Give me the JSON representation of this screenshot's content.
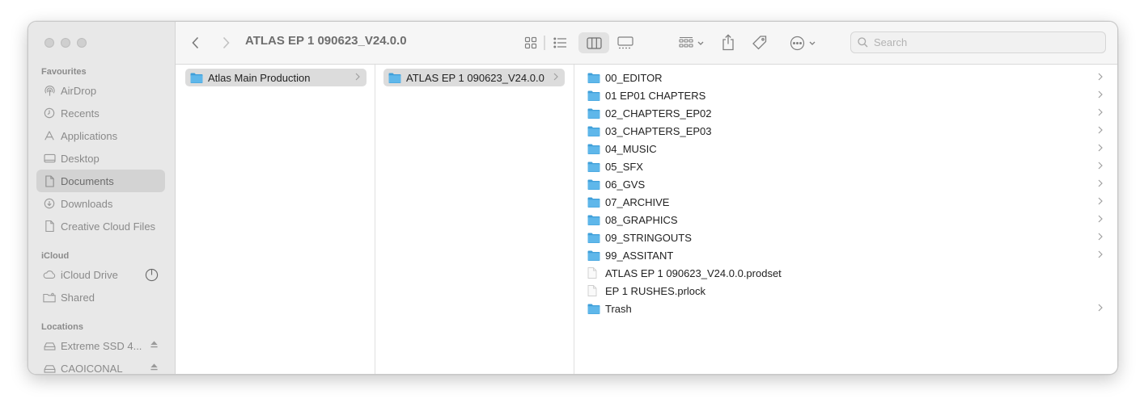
{
  "window": {
    "path_title": "ATLAS EP 1 090623_V24.0.0"
  },
  "search": {
    "placeholder": "Search"
  },
  "sidebar": {
    "sections": [
      {
        "label": "Favourites",
        "items": [
          {
            "label": "AirDrop",
            "icon": "airdrop-icon"
          },
          {
            "label": "Recents",
            "icon": "clock-icon"
          },
          {
            "label": "Applications",
            "icon": "applications-icon"
          },
          {
            "label": "Desktop",
            "icon": "desktop-icon"
          },
          {
            "label": "Documents",
            "icon": "document-icon",
            "selected": true
          },
          {
            "label": "Downloads",
            "icon": "download-icon"
          },
          {
            "label": "Creative Cloud Files",
            "icon": "file-icon"
          }
        ]
      },
      {
        "label": "iCloud",
        "items": [
          {
            "label": "iCloud Drive",
            "icon": "cloud-icon"
          },
          {
            "label": "Shared",
            "icon": "shared-folder-icon"
          }
        ]
      },
      {
        "label": "Locations",
        "items": [
          {
            "label": "Extreme SSD 4...",
            "icon": "drive-icon"
          },
          {
            "label": "CAOICONAL",
            "icon": "drive-icon"
          }
        ]
      }
    ]
  },
  "columns": {
    "col1": [
      {
        "label": "Atlas Main Production",
        "type": "folder",
        "selected": true
      }
    ],
    "col2": [
      {
        "label": "ATLAS EP 1 090623_V24.0.0",
        "type": "folder",
        "selected": true
      }
    ],
    "col3": [
      {
        "label": "00_EDITOR",
        "type": "folder"
      },
      {
        "label": "01 EP01 CHAPTERS",
        "type": "folder"
      },
      {
        "label": "02_CHAPTERS_EP02",
        "type": "folder"
      },
      {
        "label": "03_CHAPTERS_EP03",
        "type": "folder"
      },
      {
        "label": "04_MUSIC",
        "type": "folder"
      },
      {
        "label": "05_SFX",
        "type": "folder"
      },
      {
        "label": "06_GVS",
        "type": "folder"
      },
      {
        "label": "07_ARCHIVE",
        "type": "folder"
      },
      {
        "label": "08_GRAPHICS",
        "type": "folder"
      },
      {
        "label": "09_STRINGOUTS",
        "type": "folder"
      },
      {
        "label": "99_ASSITANT",
        "type": "folder"
      },
      {
        "label": "ATLAS EP 1 090623_V24.0.0.prodset",
        "type": "file"
      },
      {
        "label": "EP 1 RUSHES.prlock",
        "type": "file"
      },
      {
        "label": "Trash",
        "type": "folder"
      }
    ]
  },
  "colors": {
    "folder": "#5fb7ea",
    "folder_dark": "#3f9fd9",
    "selection": "#dcdcdc"
  }
}
